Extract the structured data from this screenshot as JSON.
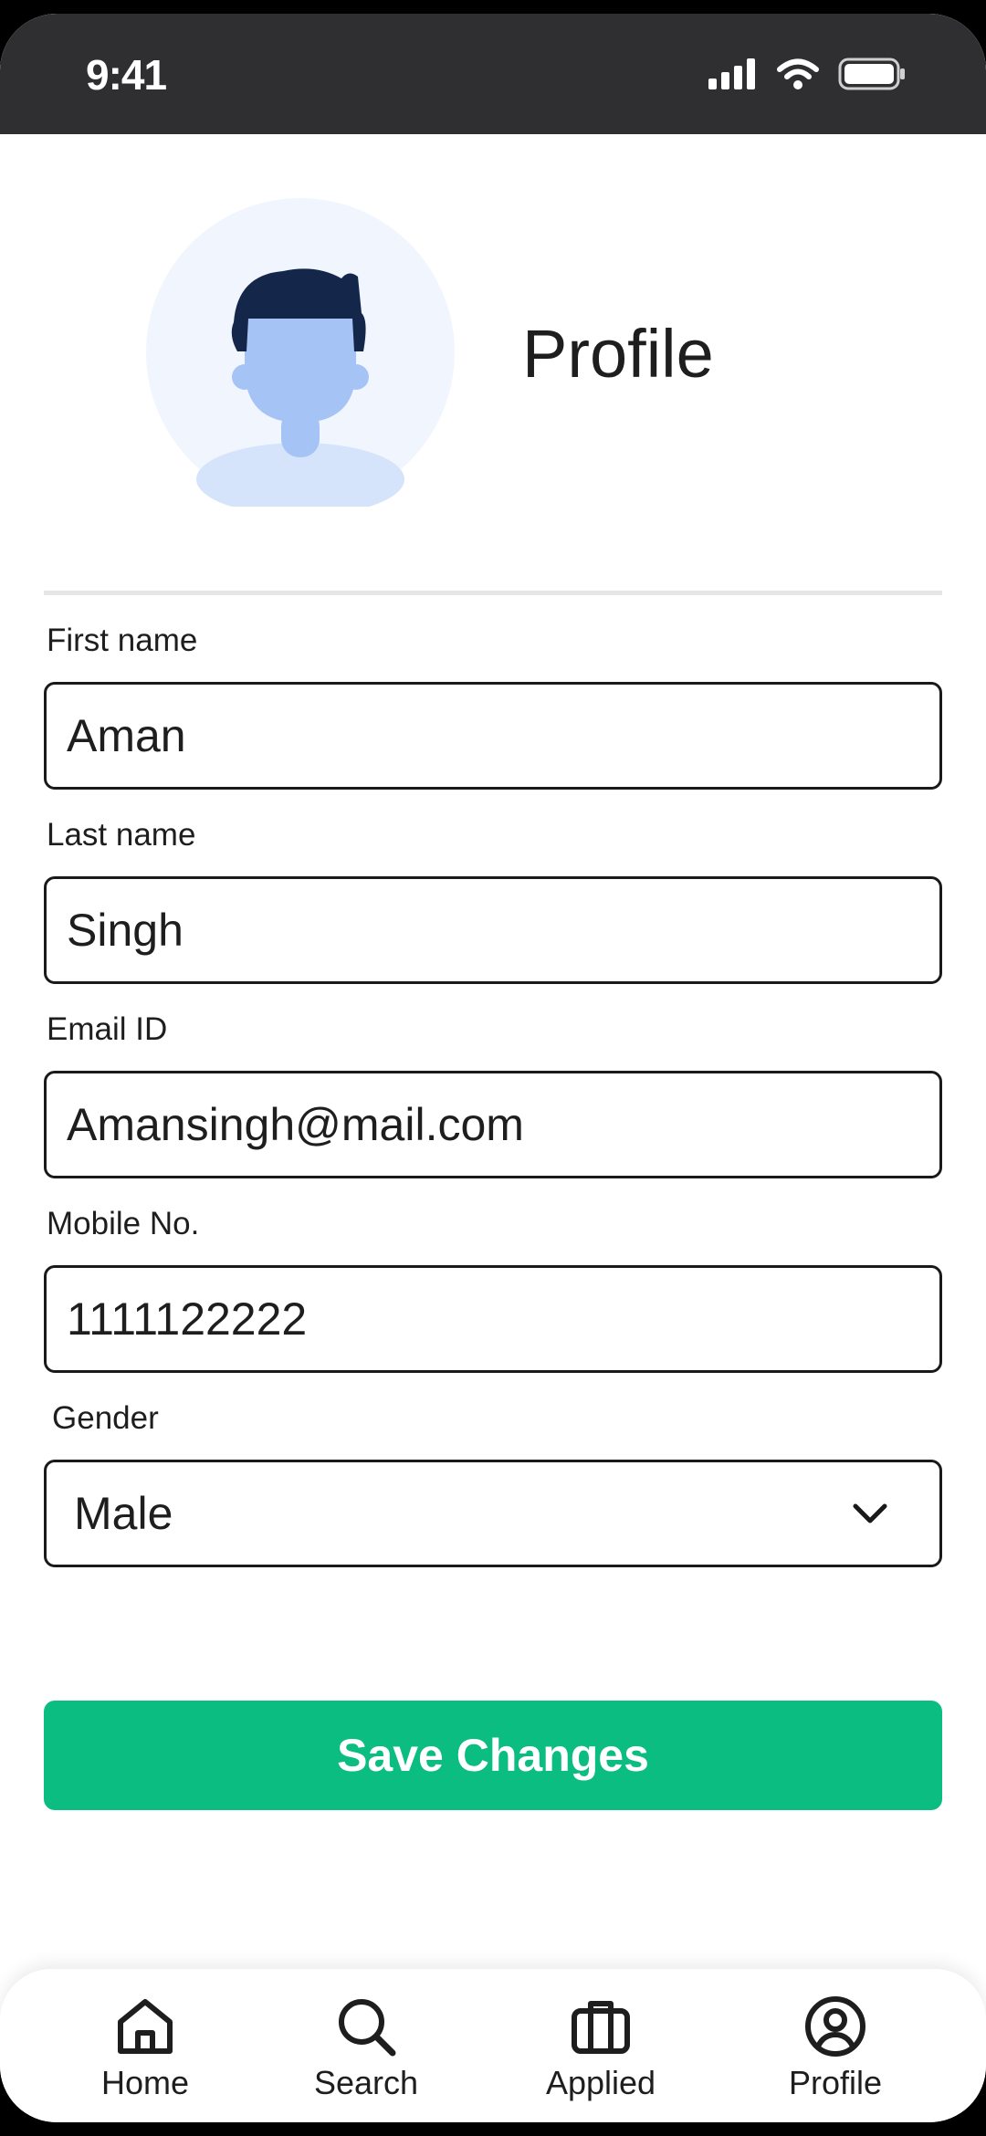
{
  "status_bar": {
    "time": "9:41",
    "icons": [
      "signal-icon",
      "wifi-icon",
      "battery-icon"
    ]
  },
  "header": {
    "title": "Profile",
    "avatar": "user-avatar-icon"
  },
  "form": {
    "first_name": {
      "label": "First name",
      "value": "Aman"
    },
    "last_name": {
      "label": "Last name",
      "value": "Singh"
    },
    "email": {
      "label": "Email ID",
      "value": "Amansingh@mail.com"
    },
    "mobile": {
      "label": "Mobile No.",
      "value": "1111122222"
    },
    "gender": {
      "label": "Gender",
      "value": "Male"
    }
  },
  "save_button": {
    "label": "Save Changes",
    "color": "#0bbd80"
  },
  "bottom_nav": {
    "items": [
      {
        "label": "Home",
        "icon": "home-icon"
      },
      {
        "label": "Search",
        "icon": "search-icon"
      },
      {
        "label": "Applied",
        "icon": "briefcase-icon"
      },
      {
        "label": "Profile",
        "icon": "user-circle-icon"
      }
    ]
  }
}
